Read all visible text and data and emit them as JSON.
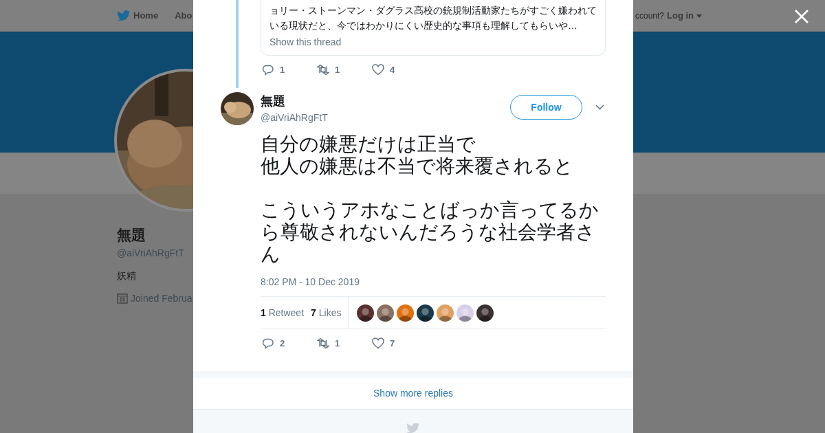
{
  "background_page": {
    "nav": [
      {
        "label": "Home"
      },
      {
        "label": "Abo"
      }
    ],
    "login_prompt": "ccount?",
    "login": "Log in",
    "profile": {
      "name": "無題",
      "handle": "@aiVriAhRgFtT",
      "bio": "妖精",
      "joined": "Joined Februa"
    }
  },
  "modal": {
    "quoted_tweet": {
      "lines": [
        "ョリー・ストーンマン・ダグラス高校の銃規制活動家たちがすごく嫌われて",
        "いる現状だと、今ではわかりにくい歴史的な事項も理解してもらいや…"
      ],
      "show_thread": "Show this thread",
      "actions": {
        "replies": "1",
        "retweets": "1",
        "likes": "4"
      }
    },
    "tweet": {
      "name": "無題",
      "handle": "@aiVriAhRgFtT",
      "follow": "Follow",
      "paragraphs": [
        {
          "lines": [
            "自分の嫌悪だけは正当で",
            "他人の嫌悪は不当で将来覆されると"
          ]
        },
        {
          "lines": [
            "こういうアホなことばっか言ってるから尊敬されないんだろうな社会学者さん"
          ]
        }
      ],
      "time": "8:02 PM - 10 Dec 2019",
      "retweet_count": "1",
      "retweet_label": "Retweet",
      "likes_count": "7",
      "likes_label": "Likes",
      "likers": [
        {
          "color": "#5a3030"
        },
        {
          "color": "#8a7060"
        },
        {
          "color": "#e07010"
        },
        {
          "color": "#1a3a4a"
        },
        {
          "color": "#e0a060"
        },
        {
          "color": "#d8d0e8"
        },
        {
          "color": "#3a3030"
        }
      ],
      "actions": {
        "replies": "2",
        "retweets": "1",
        "likes": "7"
      }
    },
    "show_more": "Show more replies"
  }
}
